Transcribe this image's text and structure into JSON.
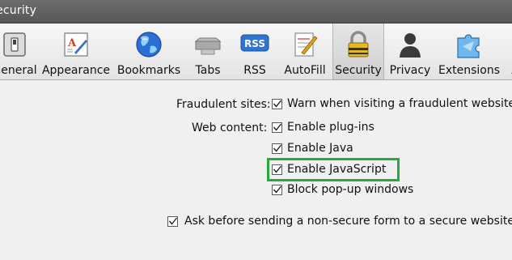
{
  "window": {
    "title": "Security"
  },
  "toolbar": {
    "items": [
      {
        "label": "General",
        "icon": "switch-icon"
      },
      {
        "label": "Appearance",
        "icon": "appearance-icon"
      },
      {
        "label": "Bookmarks",
        "icon": "globe-icon"
      },
      {
        "label": "Tabs",
        "icon": "tabs-icon"
      },
      {
        "label": "RSS",
        "icon": "rss-icon"
      },
      {
        "label": "AutoFill",
        "icon": "autofill-icon"
      },
      {
        "label": "Security",
        "icon": "lock-icon",
        "selected": true
      },
      {
        "label": "Privacy",
        "icon": "silhouette-icon"
      },
      {
        "label": "Extensions",
        "icon": "puzzle-icon"
      }
    ]
  },
  "security": {
    "fraudulent_label": "Fraudulent sites:",
    "warn_fraudulent": {
      "label": "Warn when visiting a fraudulent website",
      "checked": true
    },
    "web_content_label": "Web content:",
    "plugins": {
      "label": "Enable plug-ins",
      "checked": true
    },
    "java": {
      "label": "Enable Java",
      "checked": true
    },
    "javascript": {
      "label": "Enable JavaScript",
      "checked": true
    },
    "popups": {
      "label": "Block pop-up windows",
      "checked": true
    },
    "ask_nonsecure": {
      "label": "Ask before sending a non-secure form to a secure website",
      "checked": true
    }
  },
  "colors": {
    "highlight": "#27a83a",
    "titlebar": "#5f5f5f",
    "rss_blue": "#2f74d0"
  }
}
